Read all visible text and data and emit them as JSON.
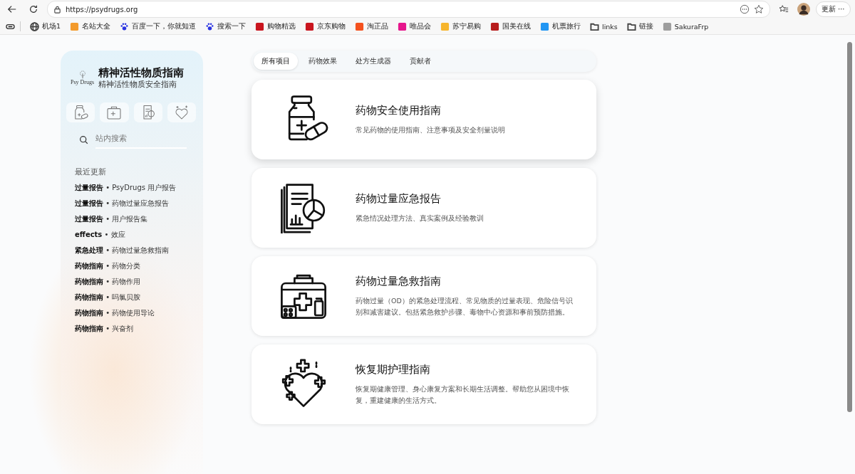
{
  "browser": {
    "url": "https://psydrugs.org",
    "update_button": "更新",
    "update_menu": "⋯",
    "bookmarks": [
      {
        "label": "机场1",
        "kind": "globe",
        "color": "#444444"
      },
      {
        "label": "名站大全",
        "kind": "tile",
        "color": "#f39a2b"
      },
      {
        "label": "百度一下，你就知道",
        "kind": "paw",
        "color": "#2932e1"
      },
      {
        "label": "搜索一下",
        "kind": "paw",
        "color": "#2932e1"
      },
      {
        "label": "购物精选",
        "kind": "tile",
        "color": "#c9151e"
      },
      {
        "label": "京东购物",
        "kind": "tile",
        "color": "#c9151e"
      },
      {
        "label": "淘正品",
        "kind": "tile",
        "color": "#f4511e"
      },
      {
        "label": "唯品会",
        "kind": "tile",
        "color": "#e6168c"
      },
      {
        "label": "苏宁易购",
        "kind": "tile",
        "color": "#f7b52c"
      },
      {
        "label": "国美在线",
        "kind": "tile",
        "color": "#b71c1c"
      },
      {
        "label": "机票旅行",
        "kind": "tile",
        "color": "#2196f3"
      },
      {
        "label": "links",
        "kind": "folder",
        "color": "#444444"
      },
      {
        "label": "链接",
        "kind": "folder",
        "color": "#444444"
      },
      {
        "label": "SakuraFrp",
        "kind": "tile",
        "color": "#9e9e9e"
      }
    ]
  },
  "sidebar": {
    "logo_text": "Psy Drugs",
    "title": "精神活性物质指南",
    "subtitle": "精神活性物质安全指南",
    "quick_icons": [
      {
        "kind": "bottle"
      },
      {
        "kind": "kit"
      },
      {
        "kind": "report"
      },
      {
        "kind": "heart"
      }
    ],
    "search": {
      "placeholder": "站内搜索"
    },
    "recent_heading": "最近更新",
    "recent": [
      "**过量报告** • PsyDrugs 用户报告",
      "**过量报告** • 药物过量应急报告",
      "**过量报告** • 用户报告集",
      "**effects** • 效应",
      "**紧急处理** • 药物过量急救指南",
      "**药物指南** • 药物分类",
      "**药物指南** • 药物作用",
      "**药物指南** • 吗氯贝胺",
      "**药物指南** • 药物使用导论",
      "**药物指南** • 兴奋剂"
    ]
  },
  "tabs": [
    {
      "label": "所有项目",
      "selected": true
    },
    {
      "label": "药物效果",
      "selected": false
    },
    {
      "label": "处方生成器",
      "selected": false
    },
    {
      "label": "贡献者",
      "selected": false
    }
  ],
  "cards": [
    {
      "kind": "bottle",
      "title": "药物安全使用指南",
      "description": "常见药物的使用指南、注意事项及安全剂量说明"
    },
    {
      "kind": "report",
      "title": "药物过量应急报告",
      "description": "紧急情况处理方法、真实案例及经验教训"
    },
    {
      "kind": "kit",
      "title": "药物过量急救指南",
      "description": "药物过量（OD）的紧急处理流程、常见物质的过量表现、危险信号识别和减害建议。包括紧急救护步骤、毒物中心资源和事前预防措施。"
    },
    {
      "kind": "heart",
      "title": "恢复期护理指南",
      "description": "恢复期健康管理、身心康复方案和长期生活调整。帮助您从困境中恢复，重建健康的生活方式。"
    }
  ]
}
